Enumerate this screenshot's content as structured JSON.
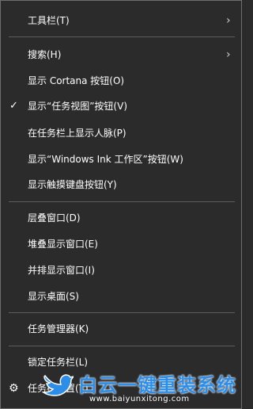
{
  "menu": {
    "items": [
      {
        "label": "工具栏(T)"
      },
      {
        "label": "搜索(H)"
      },
      {
        "label": "显示 Cortana 按钮(O)"
      },
      {
        "label": "显示“任务视图”按钮(V)"
      },
      {
        "label": "在任务栏上显示人脉(P)"
      },
      {
        "label": "显示“Windows Ink 工作区”按钮(W)"
      },
      {
        "label": "显示触摸键盘按钮(Y)"
      },
      {
        "label": "层叠窗口(D)"
      },
      {
        "label": "堆叠显示窗口(E)"
      },
      {
        "label": "并排显示窗口(I)"
      },
      {
        "label": "显示桌面(S)"
      },
      {
        "label": "任务管理器(K)"
      },
      {
        "label": "锁定任务栏(L)"
      },
      {
        "label": "任务栏设置(T)"
      }
    ],
    "submenu_arrow": "›",
    "check_mark": "✓",
    "settings_icon": "⚙"
  },
  "watermark": {
    "title": "白云一键重装系统",
    "url": "www.baiyunxitong.com",
    "icon": "bird-logo"
  },
  "colors": {
    "background": "#2b2b2b",
    "text": "#ffffff",
    "separator": "#5c5c5c",
    "watermark_blue": "#2c8ee8"
  }
}
